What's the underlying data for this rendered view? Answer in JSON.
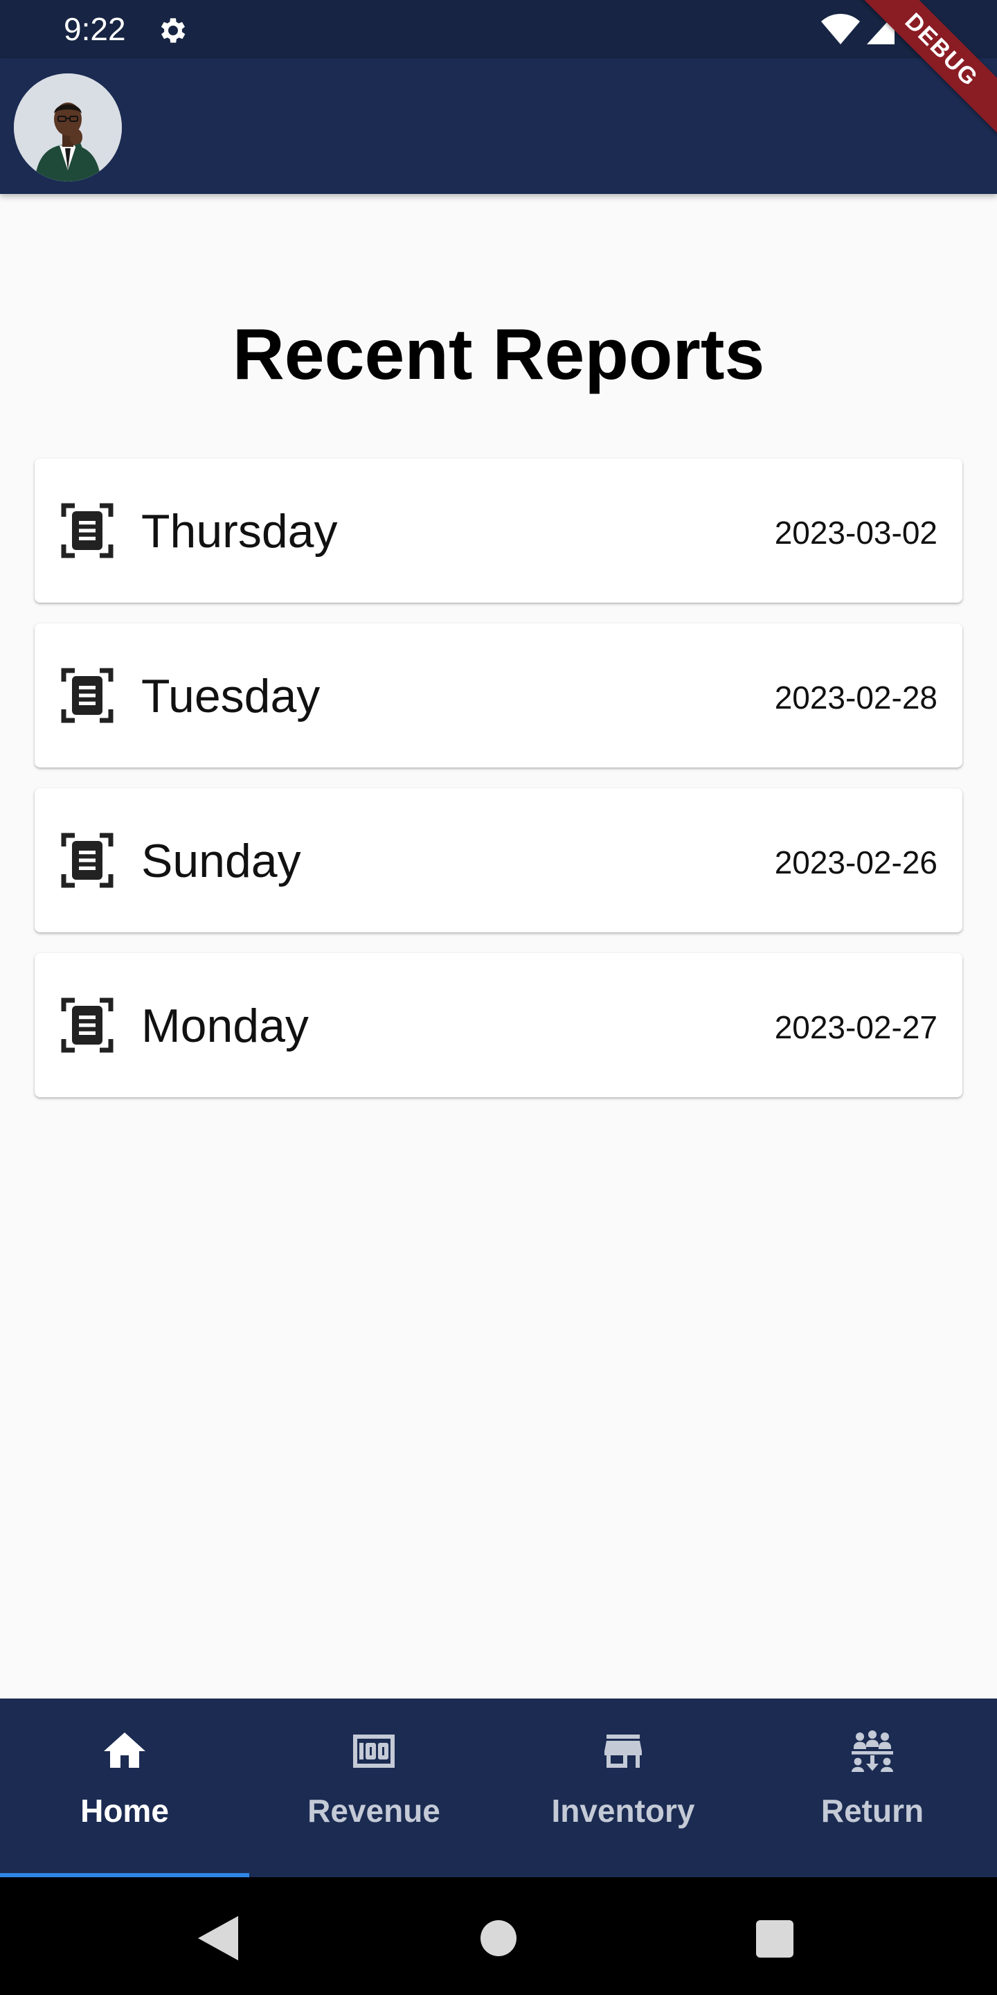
{
  "status_bar": {
    "time": "9:22",
    "icons": [
      "gear-icon",
      "wifi-icon",
      "signal-icon",
      "battery-icon"
    ]
  },
  "app_bar": {
    "avatar": "profile-photo",
    "background_color": "#1b2b52"
  },
  "debug_banner": {
    "label": "DEBUG"
  },
  "main": {
    "title": "Recent Reports",
    "reports": [
      {
        "day": "Thursday",
        "date": "2023-03-02",
        "icon": "document-scan-icon"
      },
      {
        "day": "Tuesday",
        "date": "2023-02-28",
        "icon": "document-scan-icon"
      },
      {
        "day": "Sunday",
        "date": "2023-02-26",
        "icon": "document-scan-icon"
      },
      {
        "day": "Monday",
        "date": "2023-02-27",
        "icon": "document-scan-icon"
      }
    ]
  },
  "bottom_nav": {
    "active_index": 0,
    "accent_color": "#2f86e8",
    "items": [
      {
        "label": "Home",
        "icon": "home-icon"
      },
      {
        "label": "Revenue",
        "icon": "money-icon"
      },
      {
        "label": "Inventory",
        "icon": "store-icon"
      },
      {
        "label": "Return",
        "icon": "group-return-icon"
      }
    ]
  },
  "system_nav": {
    "icons": [
      "back-icon",
      "home-circle-icon",
      "recents-icon"
    ]
  }
}
